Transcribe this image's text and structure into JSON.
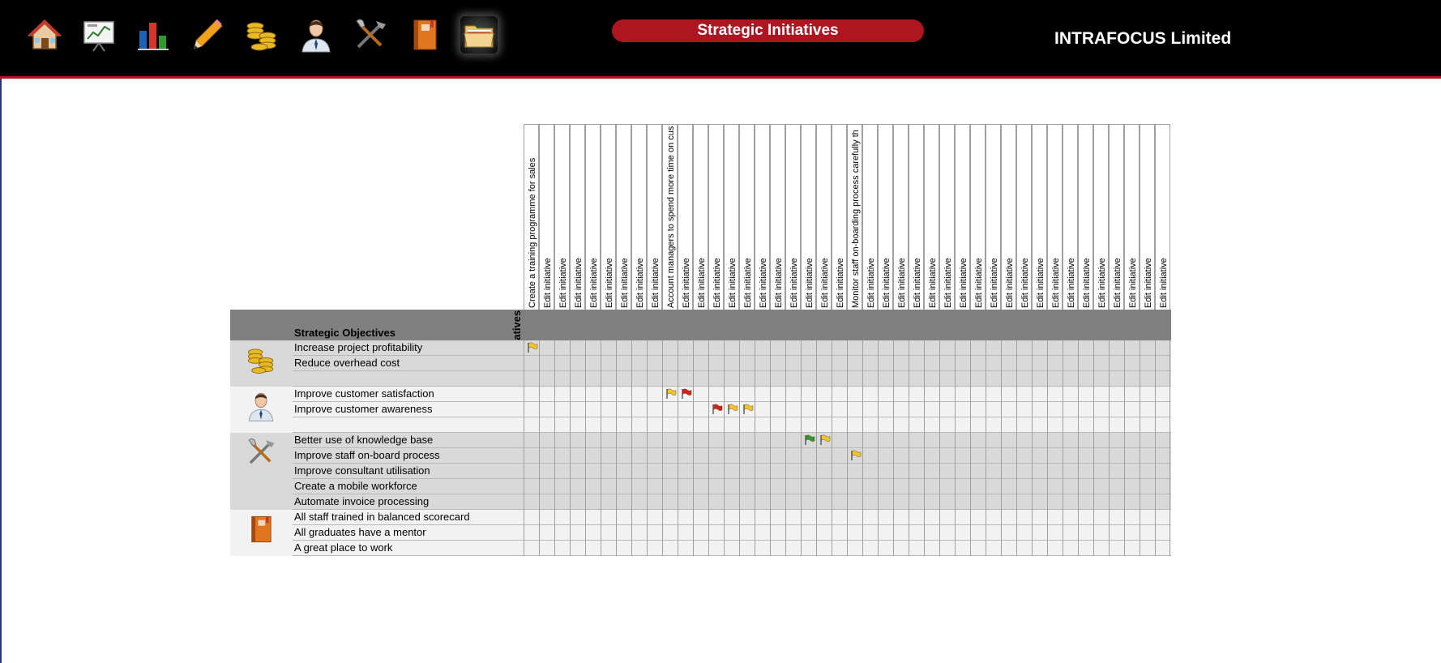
{
  "header": {
    "title": "Strategic Initiatives",
    "company": "INTRAFOCUS Limited",
    "nav_icons": [
      {
        "name": "home-icon"
      },
      {
        "name": "presentation-chart-icon"
      },
      {
        "name": "bar-chart-icon"
      },
      {
        "name": "pencil-icon"
      },
      {
        "name": "gold-coins-icon"
      },
      {
        "name": "customer-person-icon"
      },
      {
        "name": "tools-icon"
      },
      {
        "name": "book-icon"
      },
      {
        "name": "folder-icon",
        "active": true
      }
    ]
  },
  "matrix": {
    "initiatives_header": "Strategic Initiatives",
    "objectives_header": "Strategic Objectives",
    "initiatives": [
      "Create a training programme for sales",
      "Edit initiative",
      "Edit initiative",
      "Edit initiative",
      "Edit initiative",
      "Edit initiative",
      "Edit initiative",
      "Edit initiative",
      "Edit initiative",
      "Account managers to spend more time on cus",
      "Edit initiative",
      "Edit initiative",
      "Edit initiative",
      "Edit initiative",
      "Edit initiative",
      "Edit initiative",
      "Edit initiative",
      "Edit initiative",
      "Edit initiative",
      "Edit initiative",
      "Edit initiative",
      "Monitor staff on-boarding process carefully th",
      "Edit initiative",
      "Edit initiative",
      "Edit initiative",
      "Edit initiative",
      "Edit initiative",
      "Edit initiative",
      "Edit initiative",
      "Edit initiative",
      "Edit initiative",
      "Edit initiative",
      "Edit initiative",
      "Edit initiative",
      "Edit initiative",
      "Edit initiative",
      "Edit initiative",
      "Edit initiative",
      "Edit initiative",
      "Edit initiative",
      "Edit initiative",
      "Edit initiative"
    ],
    "groups": [
      {
        "icon": "gold-coins-icon",
        "shade": "#d9d9d9",
        "rows": [
          {
            "label": "Increase project profitability",
            "flags": [
              {
                "col": 0,
                "color": "#f2c230"
              }
            ]
          },
          {
            "label": "Reduce overhead cost",
            "flags": []
          },
          {
            "label": "",
            "flags": []
          }
        ]
      },
      {
        "icon": "customer-person-icon",
        "shade": "#f2f2f2",
        "rows": [
          {
            "label": "Improve customer satisfaction",
            "flags": [
              {
                "col": 9,
                "color": "#f2c230"
              },
              {
                "col": 10,
                "color": "#d42020"
              }
            ]
          },
          {
            "label": "Improve customer awareness",
            "flags": [
              {
                "col": 12,
                "color": "#d42020"
              },
              {
                "col": 13,
                "color": "#f2c230"
              },
              {
                "col": 14,
                "color": "#f2c230"
              }
            ]
          },
          {
            "label": "",
            "flags": []
          }
        ]
      },
      {
        "icon": "tools-icon",
        "shade": "#d9d9d9",
        "rows": [
          {
            "label": "Better use of knowledge base",
            "flags": [
              {
                "col": 18,
                "color": "#2e9a2e"
              },
              {
                "col": 19,
                "color": "#f2c230"
              }
            ]
          },
          {
            "label": "Improve staff on-board process",
            "flags": [
              {
                "col": 21,
                "color": "#f2c230"
              }
            ]
          },
          {
            "label": "Improve consultant utilisation",
            "flags": []
          },
          {
            "label": "Create a mobile workforce",
            "flags": []
          },
          {
            "label": "Automate invoice processing",
            "flags": []
          }
        ]
      },
      {
        "icon": "book-icon",
        "shade": "#f2f2f2",
        "rows": [
          {
            "label": "All staff trained in balanced scorecard",
            "flags": []
          },
          {
            "label": "All graduates have a mentor",
            "flags": []
          },
          {
            "label": "A great place to work",
            "flags": []
          }
        ]
      }
    ]
  }
}
